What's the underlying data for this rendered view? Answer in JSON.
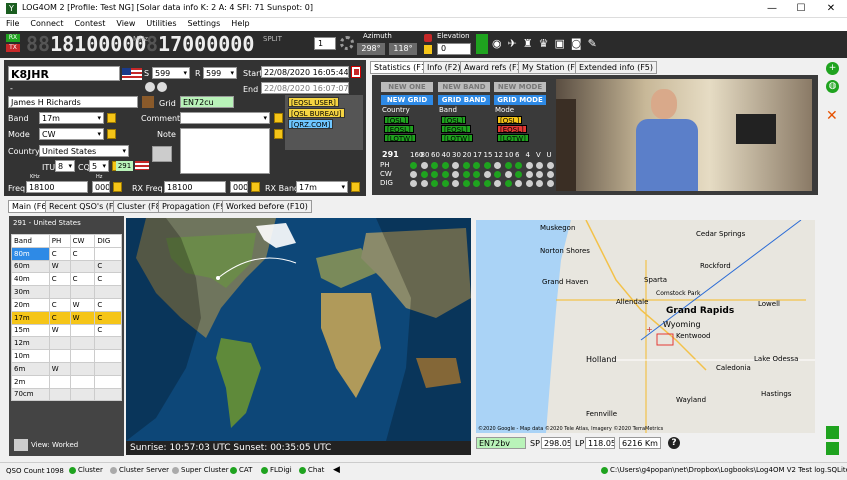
{
  "title": "LOG4OM 2 [Profile: Test NG] [Solar data info K: 2 A: 4 SFI: 71 Sunspot: 0]",
  "menu": [
    "File",
    "Connect",
    "Contest",
    "View",
    "Utilities",
    "Settings",
    "Help"
  ],
  "freqbar": {
    "rx": "RX",
    "tx": "TX",
    "tx_freq": "18100000",
    "rx_freq_dim": "17000000",
    "khz": "KHz",
    "stepper": "1",
    "azimuth_label": "Azimuth",
    "azimuth": "298°",
    "azimuth2": "118°",
    "elevation_label": "Elevation",
    "elevation": "0",
    "mhz_lbl": "MHz",
    "split_lbl": "SPLIT"
  },
  "qso": {
    "callsign": "K8JHR",
    "s_label": "S",
    "s_value": "599",
    "r_label": "R",
    "r_value": "599",
    "start_label": "Start",
    "start": "22/08/2020 16:05:44",
    "end_label": "End",
    "end": "22/08/2020 16:07:07",
    "dash": "-",
    "name": "James H Richards",
    "grid_label": "Grid",
    "grid": "EN72cu",
    "band_label": "Band",
    "band": "17m",
    "mode_label": "Mode",
    "mode": "CW",
    "country_label": "Country",
    "country": "United States",
    "comment_label": "Comment",
    "note_label": "Note",
    "itu_label": "ITU",
    "itu": "8",
    "cq_label": "CQ",
    "cq": "5",
    "dxcc": "291",
    "freq_label": "Freq",
    "khz": "KHz",
    "hz": "Hz",
    "freq": "18100",
    "freq_hz": "000",
    "rxfreq_label": "RX Freq",
    "rxfreq": "18100",
    "rxfreq_hz": "000",
    "rxband_label": "RX Band",
    "rxband": "17m",
    "tags": [
      "[EQSL USER]",
      "[QSL BUREAU]",
      "[QRZ.COM]"
    ]
  },
  "stats": {
    "tabs": [
      "Statistics (F1)",
      "Info (F2)",
      "Award refs (F3)",
      "My Station (F4)",
      "Extended info (F5)"
    ],
    "top_buttons": [
      "NEW ONE",
      "NEW BAND",
      "NEW MODE"
    ],
    "mid_buttons": [
      "NEW GRID",
      "GRID BAND",
      "GRID MODE"
    ],
    "col_labels": [
      "Country",
      "Band",
      "Mode"
    ],
    "col1": [
      "[QSL]",
      "[EQSL]",
      "[LOTW]"
    ],
    "col2": [
      "[QSL]",
      "[EQSL]",
      "[LOTW]"
    ],
    "col3": [
      "[QSL]",
      "[EQSL]",
      "[LOTW]"
    ],
    "dxcc": "291",
    "bands": [
      "160",
      "80",
      "60",
      "40",
      "30",
      "20",
      "17",
      "15",
      "12",
      "10",
      "6",
      "4",
      "V",
      "U"
    ],
    "rows": [
      "PH",
      "CW",
      "DIG"
    ]
  },
  "main_tabs": [
    "Main (F6)",
    "Recent QSO's (F7)",
    "Cluster (F8)",
    "Propagation (F9)",
    "Worked before (F10)"
  ],
  "bandtable": {
    "header": "291 - United States",
    "cols": [
      "Band",
      "PH",
      "CW",
      "DIG"
    ],
    "rows": [
      [
        "80m",
        "C",
        "C",
        ""
      ],
      [
        "60m",
        "W",
        "",
        "C"
      ],
      [
        "40m",
        "C",
        "C",
        "C"
      ],
      [
        "30m",
        "",
        "",
        ""
      ],
      [
        "20m",
        "C",
        "W",
        "C"
      ],
      [
        "17m",
        "C",
        "W",
        "C"
      ],
      [
        "15m",
        "W",
        "",
        "C"
      ],
      [
        "12m",
        "",
        "",
        ""
      ],
      [
        "10m",
        "",
        "",
        ""
      ],
      [
        "6m",
        "W",
        "",
        ""
      ],
      [
        "2m",
        "",
        "",
        ""
      ],
      [
        "70cm",
        "",
        "",
        ""
      ]
    ],
    "view_label": "View:",
    "view_value": "Worked"
  },
  "sun": "Sunrise: 10:57:03 UTC  Sunset: 00:35:05 UTC",
  "localmap": {
    "places": [
      "Muskegon",
      "Cedar Springs",
      "Norton Shores",
      "Rockford",
      "Sparta",
      "Grand Haven",
      "Comstock Park",
      "Allendale",
      "Grand Rapids",
      "Lowell",
      "Wyoming",
      "Kentwood",
      "Holland",
      "Caledonia",
      "Lake Odessa",
      "Hastings",
      "Fennville",
      "Wayland"
    ],
    "copyright": "©2020 Google - Map data ©2020 Tele Atlas, Imagery ©2020 TerraMetrics",
    "grid": "EN72bv",
    "sp_label": "SP",
    "sp": "298.05",
    "lp_label": "LP",
    "lp": "118.05",
    "dist": "6216 Km",
    "help": "?"
  },
  "status": {
    "qso_count_label": "QSO Count",
    "qso_count": "1098",
    "items": [
      "Cluster",
      "Cluster Server",
      "Super Cluster",
      "CAT",
      "FLDigi",
      "Chat"
    ],
    "path": "C:\\Users\\g4popan\\net\\Dropbox\\Logbooks\\Log4OM V2 Test log.SQLite"
  }
}
